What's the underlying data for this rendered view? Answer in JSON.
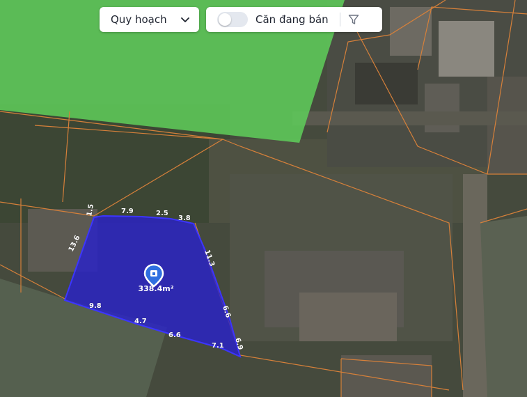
{
  "toolbar": {
    "planning_label": "Quy hoạch",
    "for_sale_label": "Căn đang bán",
    "for_sale_toggle_on": false
  },
  "icons": {
    "planning_chevron": "chevron-down-icon",
    "filter": "filter-icon",
    "parcel_marker": "map-pin-icon"
  },
  "parcel": {
    "area_label": "338.4m²",
    "edge_lengths": [
      "1.5",
      "7.9",
      "2.5",
      "3.8",
      "11.3",
      "6.6",
      "6.9",
      "7.1",
      "6.6",
      "4.7",
      "9.8",
      "13.6"
    ]
  },
  "colors": {
    "parcel_fill": "#2a22c8",
    "parcel_stroke": "#3c35ff",
    "planning_zone": "#5fcf5a",
    "lot_boundary": "#d6803a",
    "marker": "#2f6fe0"
  }
}
